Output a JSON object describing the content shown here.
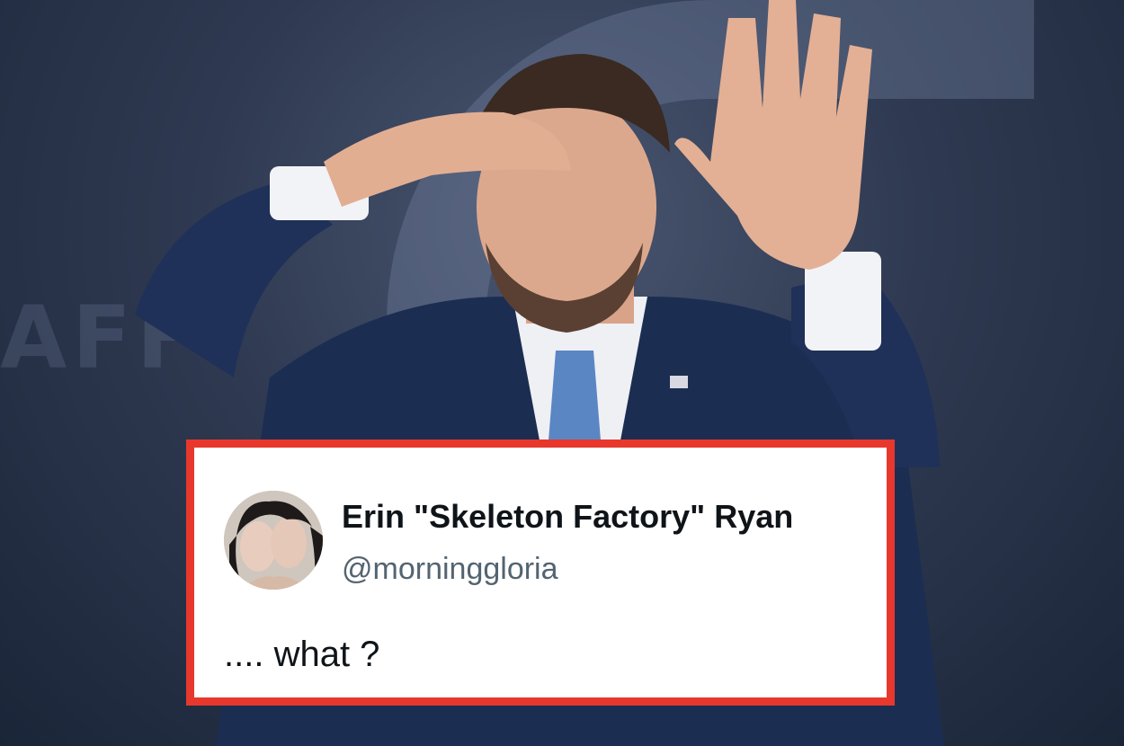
{
  "tweet": {
    "display_name": "Erin \"Skeleton Factory\" Ryan",
    "handle": "@morninggloria",
    "text": ".... what ?",
    "border_color": "#e8382d"
  }
}
